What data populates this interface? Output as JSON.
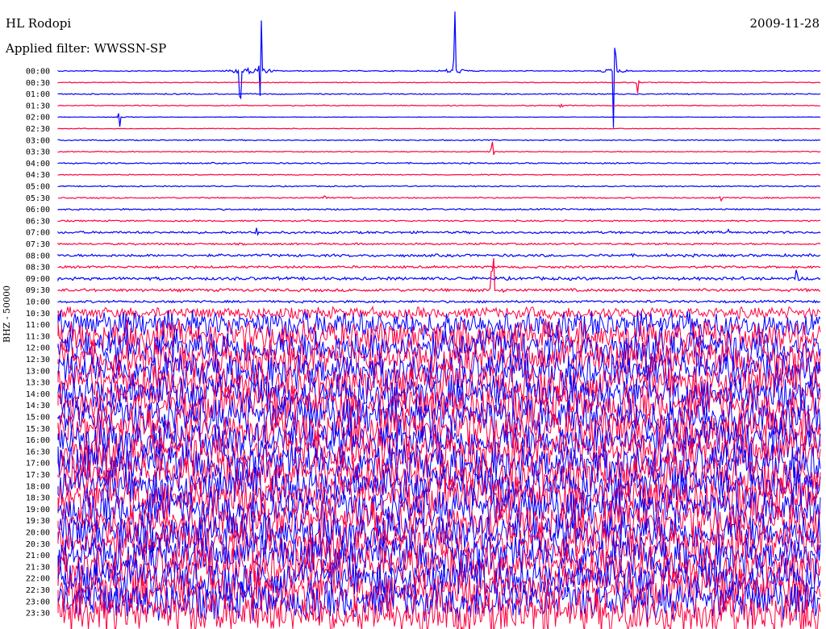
{
  "header": {
    "station": "HL Rodopi",
    "filter": "Applied filter: WWSSN-SP",
    "date": "2009-11-28"
  },
  "chart_data": {
    "type": "line",
    "title": "HL Rodopi",
    "ylabel": "BHZ - 50000",
    "row_labels": [
      "00:00",
      "00:30",
      "01:00",
      "01:30",
      "02:00",
      "02:30",
      "03:00",
      "03:30",
      "04:00",
      "04:30",
      "05:00",
      "05:30",
      "06:00",
      "06:30",
      "07:00",
      "07:30",
      "08:00",
      "08:30",
      "09:00",
      "09:30",
      "10:00",
      "10:30",
      "11:00",
      "11:30",
      "12:00",
      "12:30",
      "13:00",
      "13:30",
      "14:00",
      "14:30",
      "15:00",
      "15:30",
      "16:00",
      "16:30",
      "17:00",
      "17:30",
      "18:00",
      "18:30",
      "19:00",
      "19:30",
      "20:00",
      "20:30",
      "21:00",
      "21:30",
      "22:00",
      "22:30",
      "23:00",
      "23:30"
    ],
    "colors": [
      "#0000ff",
      "#ff0040",
      "#000000"
    ],
    "noise_level": [
      0.5,
      0.4,
      0.6,
      0.5,
      0.2,
      0.4,
      0.6,
      0.5,
      0.7,
      0.5,
      0.6,
      0.7,
      0.8,
      0.8,
      1.2,
      1,
      1.4,
      1.2,
      1.6,
      1.5,
      1.2,
      6,
      14,
      16,
      18,
      18,
      18,
      19,
      19,
      19,
      20,
      20,
      20,
      20,
      20,
      20,
      20,
      20,
      20,
      20,
      20,
      20,
      20,
      20,
      20,
      20,
      20,
      22
    ],
    "events": [
      {
        "row": 0,
        "t": 0.73,
        "amp": 80
      },
      {
        "row": 0,
        "t": 0.24,
        "amp": 90
      },
      {
        "row": 0,
        "t": 0.265,
        "amp": 90
      },
      {
        "row": 0,
        "t": 0.52,
        "amp": 95
      },
      {
        "row": 1,
        "t": 0.76,
        "amp": 15
      },
      {
        "row": 3,
        "t": 0.66,
        "amp": 4
      },
      {
        "row": 4,
        "t": 0.08,
        "amp": 15
      },
      {
        "row": 7,
        "t": 0.57,
        "amp": 12
      },
      {
        "row": 11,
        "t": 0.35,
        "amp": 3
      },
      {
        "row": 11,
        "t": 0.87,
        "amp": 3
      },
      {
        "row": 14,
        "t": 0.26,
        "amp": 6
      },
      {
        "row": 14,
        "t": 0.88,
        "amp": 4
      },
      {
        "row": 18,
        "t": 0.97,
        "amp": 10
      },
      {
        "row": 19,
        "t": 0.57,
        "amp": 40
      }
    ]
  }
}
